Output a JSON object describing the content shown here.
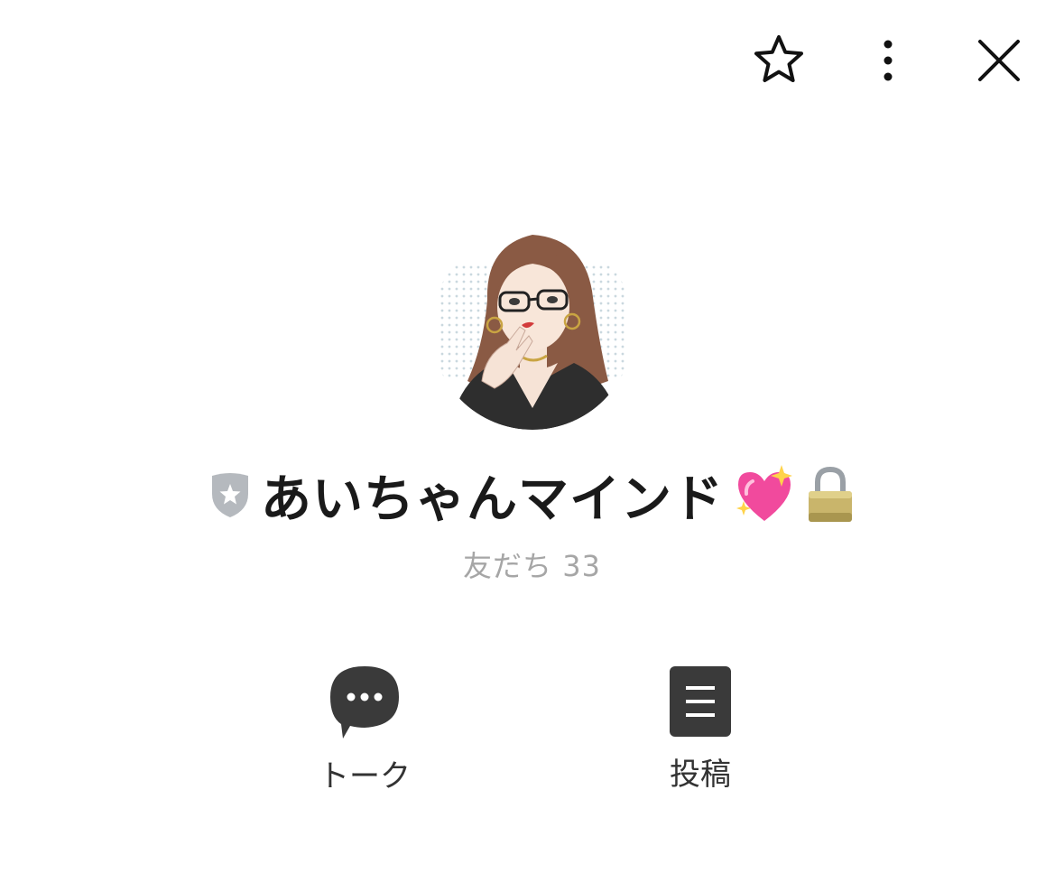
{
  "header": {
    "favorite_icon": "star-outline-icon",
    "more_icon": "vertical-ellipsis-icon",
    "close_icon": "close-x-icon"
  },
  "profile": {
    "badge_icon": "shield-star-badge-icon",
    "name": "あいちゃんマインド",
    "emoji_heart": "💖",
    "emoji_lock": "🔒",
    "friends_label": "友だち 33"
  },
  "actions": [
    {
      "label": "トーク",
      "icon": "chat-bubble-icon"
    },
    {
      "label": "投稿",
      "icon": "post-document-icon"
    }
  ],
  "colors": {
    "text_primary": "#1a1a1a",
    "text_muted": "#a6a6a6",
    "icon_dark": "#3a3a3a",
    "badge_gray": "#b5b9be"
  }
}
